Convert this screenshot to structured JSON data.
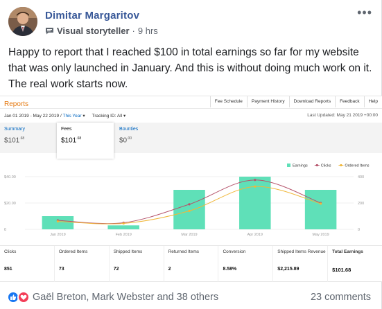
{
  "post": {
    "author": "Dimitar Margaritov",
    "badge_label": "Visual storyteller",
    "separator": "·",
    "time": "9 hrs",
    "more_label": "•••",
    "text": "Happy to report that I reached $100 in total earnings so far for my website that was only launched in January. And this is without doing much work on it. The real work starts now."
  },
  "report": {
    "title": "Reports",
    "nav": [
      "Fee Schedule",
      "Payment History",
      "Download Reports",
      "Feedback",
      "Help"
    ],
    "date_range": "Jan 01 2019 - May 22 2019 /",
    "period": "This Year",
    "period_caret": "▾",
    "tracking": "Tracking ID: All",
    "tracking_caret": "▾",
    "updated": "Last Updated: May 21 2019 +00:00",
    "tabs": [
      {
        "label": "Summary",
        "value": "$101",
        "cents": ".68"
      },
      {
        "label": "Fees",
        "value": "$101",
        "cents": ".68"
      },
      {
        "label": "Bounties",
        "value": "$0",
        "cents": ".00"
      }
    ],
    "stats": [
      {
        "label": "Clicks",
        "value": "851"
      },
      {
        "label": "Ordered Items",
        "value": "73"
      },
      {
        "label": "Shipped Items",
        "value": "72"
      },
      {
        "label": "Returned Items",
        "value": "2"
      },
      {
        "label": "Conversion",
        "value": "8.58%"
      },
      {
        "label": "Shipped Items Revenue",
        "value": "$2,215.89"
      },
      {
        "label": "Total Earnings",
        "value": "$101.68"
      }
    ]
  },
  "chart_data": {
    "type": "bar",
    "categories": [
      "Jan 2019",
      "Feb 2019",
      "Mar 2019",
      "Apr 2019",
      "May 2019"
    ],
    "series": [
      {
        "name": "Earnings",
        "type": "bar",
        "axis": "left",
        "values": [
          10,
          3,
          30,
          40,
          30
        ]
      },
      {
        "name": "Clicks",
        "type": "line",
        "axis": "right",
        "values": [
          68,
          50,
          190,
          375,
          200
        ]
      },
      {
        "name": "Ordered Items",
        "type": "line",
        "axis": "right",
        "values": [
          60,
          45,
          140,
          325,
          195
        ]
      }
    ],
    "left_ticks": [
      "$40.00",
      "$20.00",
      "0"
    ],
    "right_ticks": [
      "400",
      "200",
      "0"
    ],
    "ylim_left": [
      0,
      40
    ],
    "ylim_right": [
      0,
      400
    ],
    "legend_position": "top-right",
    "colors": {
      "Earnings": "#5fe0b8",
      "Clicks": "#b5536b",
      "Ordered Items": "#f0b73a"
    }
  },
  "footer": {
    "reactors": "Gaël Breton, Mark Webster and 38 others",
    "comments": "23 comments"
  },
  "colors": {
    "fb_link": "#385898",
    "amazon_orange": "#e47911",
    "amazon_link": "#0066c0"
  }
}
